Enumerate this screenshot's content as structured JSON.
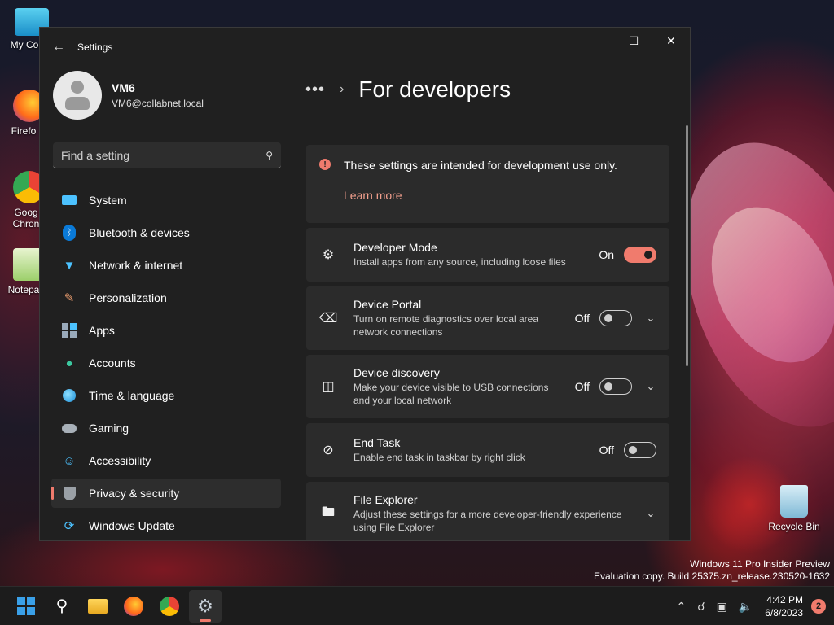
{
  "desktop": {
    "icons": [
      {
        "label": "My Com"
      },
      {
        "label": "Firefo"
      },
      {
        "label": "Goog Chron"
      },
      {
        "label": "Notepa"
      }
    ],
    "recycle_bin": "Recycle Bin",
    "watermark_line1": "Windows 11 Pro Insider Preview",
    "watermark_line2": "Evaluation copy. Build 25375.zn_release.230520-1632"
  },
  "window": {
    "title": "Settings",
    "controls": {
      "minimize": "—",
      "maximize": "☐",
      "close": "✕"
    }
  },
  "profile": {
    "name": "VM6",
    "email": "VM6@collabnet.local"
  },
  "search": {
    "placeholder": "Find a setting"
  },
  "sidebar": {
    "items": [
      {
        "label": "System",
        "icon": "system-icon"
      },
      {
        "label": "Bluetooth & devices",
        "icon": "bluetooth-icon"
      },
      {
        "label": "Network & internet",
        "icon": "network-icon"
      },
      {
        "label": "Personalization",
        "icon": "brush-icon"
      },
      {
        "label": "Apps",
        "icon": "apps-icon"
      },
      {
        "label": "Accounts",
        "icon": "accounts-icon"
      },
      {
        "label": "Time & language",
        "icon": "globe-icon"
      },
      {
        "label": "Gaming",
        "icon": "gamepad-icon"
      },
      {
        "label": "Accessibility",
        "icon": "accessibility-icon"
      },
      {
        "label": "Privacy & security",
        "icon": "shield-icon",
        "active": true
      },
      {
        "label": "Windows Update",
        "icon": "update-icon"
      }
    ]
  },
  "main": {
    "breadcrumb_more": "•••",
    "page_title": "For developers",
    "notice": {
      "message": "These settings are intended for development use only.",
      "link": "Learn more"
    },
    "settings": [
      {
        "title": "Developer Mode",
        "desc": "Install apps from any source, including loose files",
        "state": "On",
        "on": true,
        "expandable": false
      },
      {
        "title": "Device Portal",
        "desc": "Turn on remote diagnostics over local area network connections",
        "state": "Off",
        "on": false,
        "expandable": true
      },
      {
        "title": "Device discovery",
        "desc": "Make your device visible to USB connections and your local network",
        "state": "Off",
        "on": false,
        "expandable": true
      },
      {
        "title": "End Task",
        "desc": "Enable end task in taskbar by right click",
        "state": "Off",
        "on": false,
        "expandable": false
      },
      {
        "title": "File Explorer",
        "desc": "Adjust these settings for a more developer-friendly experience using File Explorer",
        "state": "",
        "on": false,
        "expandable": true
      }
    ]
  },
  "taskbar": {
    "clock_time": "4:42 PM",
    "clock_date": "6/8/2023",
    "notification_count": "2"
  },
  "colors": {
    "accent": "#f07b6d",
    "window_bg": "#202020",
    "card_bg": "#2b2b2b"
  }
}
